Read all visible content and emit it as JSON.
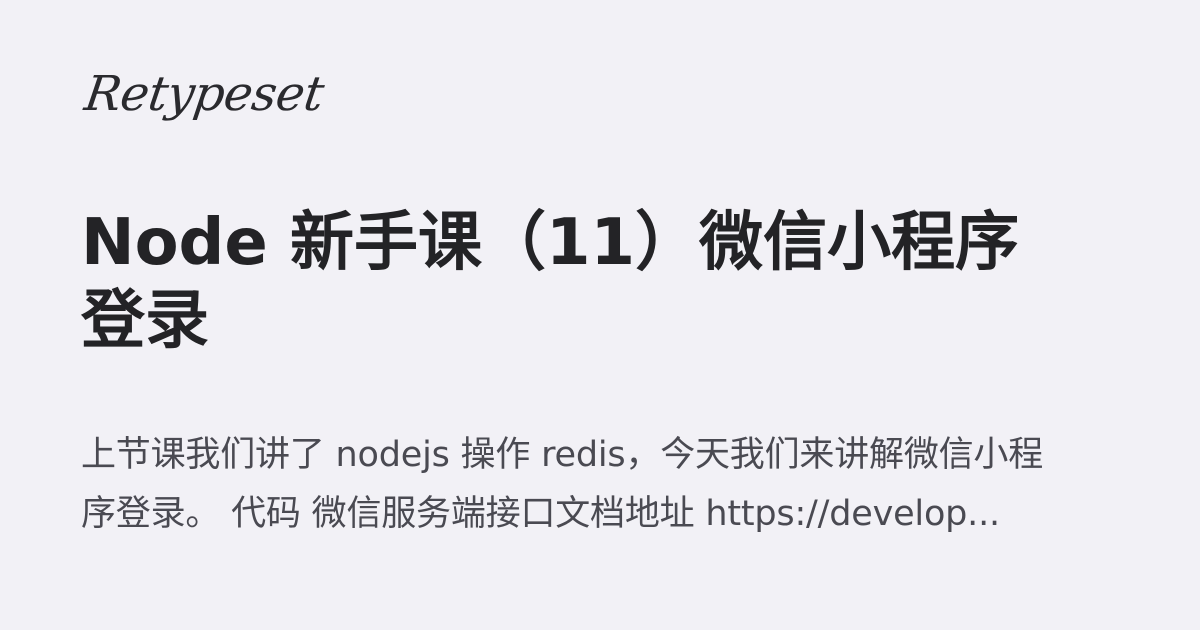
{
  "site": {
    "brand": "Retypeset"
  },
  "post": {
    "title": "Node 新手课（11）微信小程序登录",
    "excerpt": "上节课我们讲了 nodejs 操作 redis，今天我们来讲解微信小程序登录。 代码 微信服务端接口文档地址 https://develop..."
  }
}
